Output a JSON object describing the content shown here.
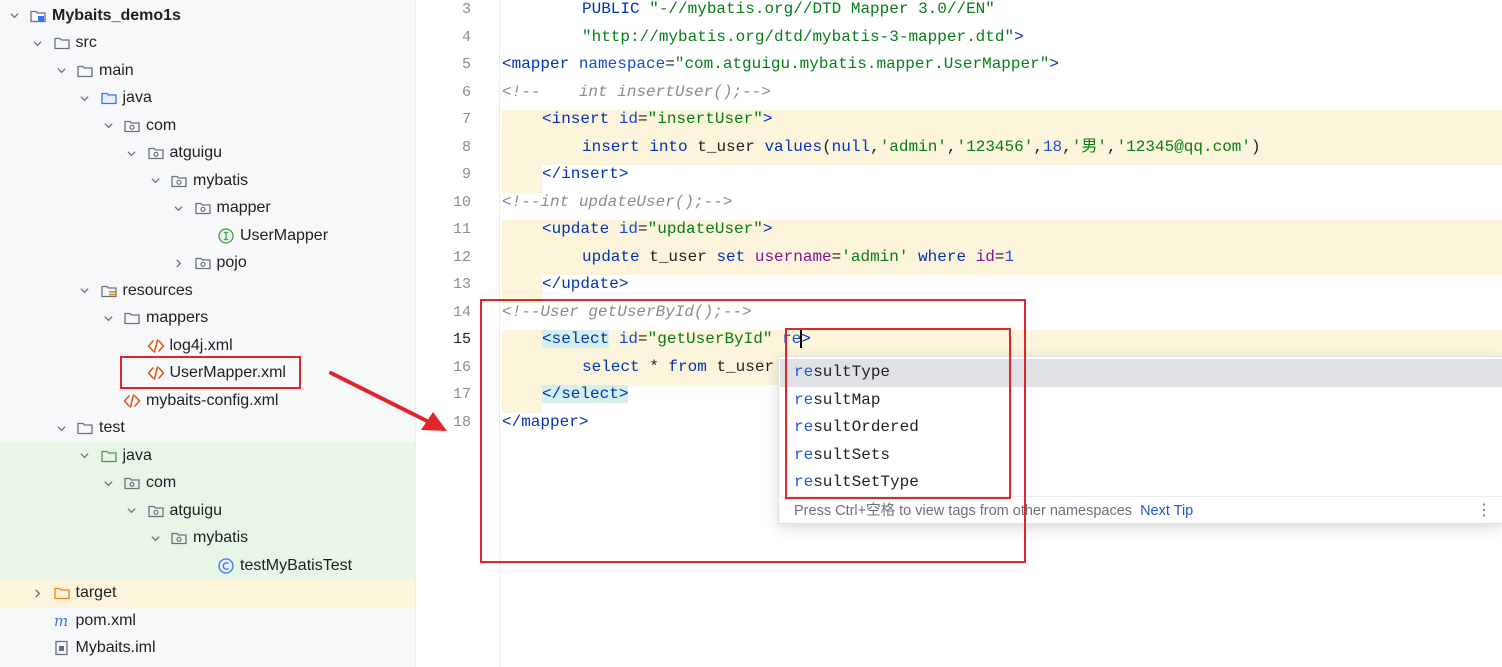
{
  "project": {
    "items": [
      {
        "label": "Mybaits_demo1s",
        "depth": 0,
        "chev": "down",
        "icon": "module-folder-icon",
        "bg": "none"
      },
      {
        "label": "src",
        "depth": 1,
        "chev": "down",
        "icon": "folder-icon",
        "bg": "none"
      },
      {
        "label": "main",
        "depth": 2,
        "chev": "down",
        "icon": "folder-icon",
        "bg": "none"
      },
      {
        "label": "java",
        "depth": 3,
        "chev": "down",
        "icon": "source-folder-icon",
        "bg": "none"
      },
      {
        "label": "com",
        "depth": 4,
        "chev": "down",
        "icon": "package-icon",
        "bg": "none"
      },
      {
        "label": "atguigu",
        "depth": 5,
        "chev": "down",
        "icon": "package-icon",
        "bg": "none"
      },
      {
        "label": "mybatis",
        "depth": 6,
        "chev": "down",
        "icon": "package-icon",
        "bg": "none"
      },
      {
        "label": "mapper",
        "depth": 7,
        "chev": "down",
        "icon": "package-icon",
        "bg": "none"
      },
      {
        "label": "UserMapper",
        "depth": 8,
        "chev": "none",
        "icon": "interface-icon",
        "bg": "none"
      },
      {
        "label": "pojo",
        "depth": 7,
        "chev": "right",
        "icon": "package-icon",
        "bg": "none"
      },
      {
        "label": "resources",
        "depth": 3,
        "chev": "down",
        "icon": "resources-folder-icon",
        "bg": "none"
      },
      {
        "label": "mappers",
        "depth": 4,
        "chev": "down",
        "icon": "folder-icon",
        "bg": "none"
      },
      {
        "label": "log4j.xml",
        "depth": 5,
        "chev": "none",
        "icon": "xml-file-icon",
        "bg": "none"
      },
      {
        "label": "UserMapper.xml",
        "depth": 5,
        "chev": "none",
        "icon": "xml-file-icon",
        "bg": "none"
      },
      {
        "label": "mybaits-config.xml",
        "depth": 4,
        "chev": "none",
        "icon": "xml-file-icon",
        "bg": "none"
      },
      {
        "label": "test",
        "depth": 2,
        "chev": "down",
        "icon": "folder-icon",
        "bg": "none"
      },
      {
        "label": "java",
        "depth": 3,
        "chev": "down",
        "icon": "test-folder-icon",
        "bg": "green"
      },
      {
        "label": "com",
        "depth": 4,
        "chev": "down",
        "icon": "package-icon",
        "bg": "green"
      },
      {
        "label": "atguigu",
        "depth": 5,
        "chev": "down",
        "icon": "package-icon",
        "bg": "green"
      },
      {
        "label": "mybatis",
        "depth": 6,
        "chev": "down",
        "icon": "package-icon",
        "bg": "green"
      },
      {
        "label": "testMyBatisTest",
        "depth": 8,
        "chev": "none",
        "icon": "class-icon",
        "bg": "green"
      },
      {
        "label": "target",
        "depth": 1,
        "chev": "right",
        "icon": "excluded-folder-icon",
        "bg": "yellow"
      },
      {
        "label": "pom.xml",
        "depth": 1,
        "chev": "none",
        "icon": "maven-icon",
        "bg": "none"
      },
      {
        "label": "Mybaits.iml",
        "depth": 1,
        "chev": "none",
        "icon": "iml-file-icon",
        "bg": "none"
      }
    ]
  },
  "editor": {
    "line_numbers": [
      "3",
      "4",
      "5",
      "6",
      "7",
      "8",
      "9",
      "10",
      "11",
      "12",
      "13",
      "14",
      "15",
      "16",
      "17",
      "18"
    ],
    "current_line": "15",
    "lines": {
      "l3": {
        "a": "PUBLIC ",
        "b": "\"-//mybatis.org//DTD Mapper 3.0//EN\""
      },
      "l4": {
        "a": "\"http://mybatis.org/dtd/mybatis-3-mapper.dtd\"",
        "b": ">"
      },
      "l5": {
        "a": "<mapper ",
        "b": "namespace",
        "c": "=",
        "d": "\"com.atguigu.mybatis.mapper.UserMapper\"",
        "e": ">"
      },
      "l6": {
        "a": "<!--    int insertUser();-->"
      },
      "l7": {
        "a": "<insert ",
        "b": "id",
        "c": "=",
        "d": "\"insertUser\"",
        "e": ">"
      },
      "l8": {
        "a": "insert ",
        "b": "into ",
        "c": "t_user ",
        "d": "values",
        "e": "(",
        "f": "null",
        ",1": ",",
        "g": "'admin'",
        ",2": ",",
        "h": "'123456'",
        ",3": ",",
        "i": "18",
        ",4": ",",
        "j": "'男'",
        ",5": ",",
        "k": "'12345@qq.com'",
        "l": ")"
      },
      "l9": {
        "a": "</insert>"
      },
      "l10": {
        "a": "<!--int updateUser();-->"
      },
      "l11": {
        "a": "<update ",
        "b": "id",
        "c": "=",
        "d": "\"updateUser\"",
        "e": ">"
      },
      "l12": {
        "a": "update ",
        "b": "t_user ",
        "c": "set ",
        "d": "username",
        "e": "=",
        "f": "'admin' ",
        "g": "where ",
        "h": "id",
        "i": "=",
        "j": "1"
      },
      "l13": {
        "a": "</update>"
      },
      "l14": {
        "a": "<!--User getUserById();-->"
      },
      "l15": {
        "a": "<select",
        "b": " ",
        "c": "id",
        "d": "=",
        "e": "\"getUserById\"",
        "f": " ",
        "g": "re",
        "h": ">"
      },
      "l16": {
        "a": "select ",
        "b": "* ",
        "c": "from ",
        "d": "t_user"
      },
      "l17": {
        "a": "</select>"
      },
      "l18": {
        "a": "</mapper>"
      }
    }
  },
  "completion": {
    "match": "re",
    "items": [
      {
        "rest": "sultType"
      },
      {
        "rest": "sultMap"
      },
      {
        "rest": "sultOrdered"
      },
      {
        "rest": "sultSets"
      },
      {
        "rest": "sultSetType"
      }
    ],
    "footer_hint": "Press Ctrl+空格 to view tags from other namespaces",
    "footer_tip": "Next Tip",
    "menu_glyph": "⋮"
  },
  "colors": {
    "annotation_red": "#e0262b",
    "xml_tag": "#0033b3",
    "xml_value": "#067d17",
    "comment": "#8c8c8c",
    "highlight_band": "#fcf5dc"
  }
}
